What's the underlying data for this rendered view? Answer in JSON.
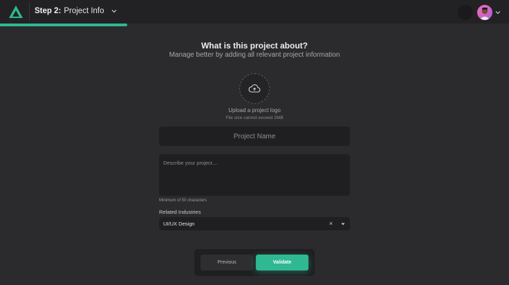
{
  "header": {
    "step_number": "Step 2:",
    "step_title": "Project Info",
    "progress_percent": 25
  },
  "page": {
    "title": "What is this project about?",
    "subtitle": "Manage better by adding all relevant project information"
  },
  "upload": {
    "label": "Upload a project logo",
    "hint": "File size cannot exceed 2MB"
  },
  "form": {
    "name_placeholder": "Project Name",
    "name_value": "",
    "description_placeholder": "Describe your project....",
    "description_value": "",
    "description_hint": "Minimum of 50 characters",
    "industries_label": "Related Industries",
    "industries_value": "UI/UX Design",
    "clear_glyph": "×"
  },
  "actions": {
    "previous_label": "Previous",
    "validate_label": "Validate"
  },
  "theme": {
    "accent": "#2fb892",
    "background": "#2b2b2d",
    "topbar": "#222224",
    "input_bg": "#1f1f21"
  },
  "icons": {
    "logo": "triangle-logo-icon",
    "step_toggle": "chevron-down-icon",
    "theme_toggle": "moon-icon",
    "avatar_menu": "chevron-down-icon",
    "upload": "cloud-upload-icon",
    "clear": "close-icon",
    "dropdown": "caret-down-icon"
  }
}
